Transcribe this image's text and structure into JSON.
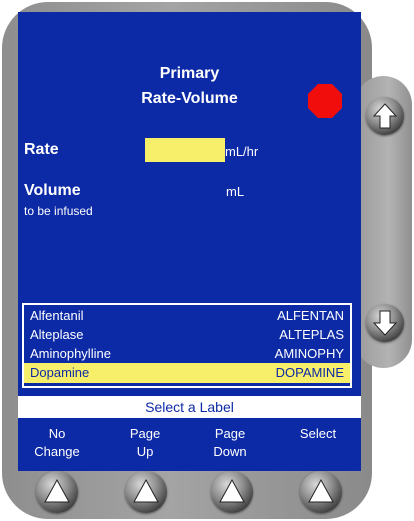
{
  "screen": {
    "title_line1": "Primary",
    "title_line2": "Rate-Volume",
    "rate_label": "Rate",
    "rate_value": "",
    "rate_unit": "mL/hr",
    "volume_label": "Volume",
    "volume_sublabel": "to be infused",
    "volume_unit": "mL",
    "stop_indicator_color": "#f20d0d",
    "highlight_color": "#f7ef6a",
    "screen_color": "#0d2aa6"
  },
  "drug_list": [
    {
      "name": "Alfentanil",
      "abbr": "ALFENTAN",
      "selected": false
    },
    {
      "name": "Alteplase",
      "abbr": "ALTEPLAS",
      "selected": false
    },
    {
      "name": "Aminophylline",
      "abbr": "AMINOPHY",
      "selected": false
    },
    {
      "name": "Dopamine",
      "abbr": "DOPAMINE",
      "selected": true
    }
  ],
  "prompt": "Select a Label",
  "softkeys": [
    {
      "line1": "No",
      "line2": "Change"
    },
    {
      "line1": "Page",
      "line2": "Up"
    },
    {
      "line1": "Page",
      "line2": "Down"
    },
    {
      "line1": "",
      "line2": "Select"
    }
  ],
  "icons": {
    "stop": "stop-octagon-icon",
    "scroll_up": "up-arrow-icon",
    "scroll_down": "down-arrow-icon",
    "softkey": "up-arrow-icon"
  }
}
